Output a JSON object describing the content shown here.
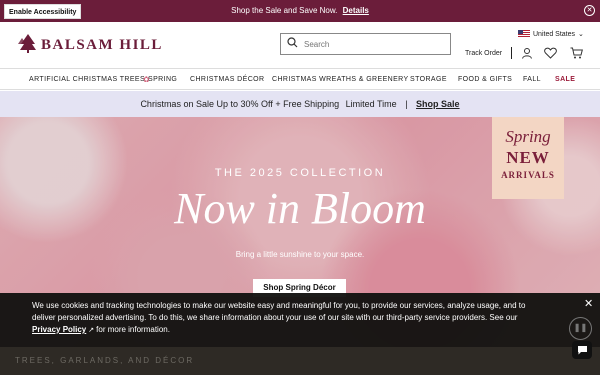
{
  "topbar": {
    "accessibility_label": "Enable Accessibility",
    "promo_text": "Shop the Sale and Save Now.",
    "promo_link": "Details",
    "close_icon": "close-circle-icon"
  },
  "header": {
    "logo_text": "BALSAM HILL",
    "search_placeholder": "Search",
    "country": "United States",
    "track_order": "Track Order",
    "icons": [
      "account-icon",
      "heart-icon",
      "cart-icon"
    ]
  },
  "nav": {
    "items": [
      "ARTIFICIAL CHRISTMAS TREES",
      "SPRING",
      "CHRISTMAS DÉCOR",
      "CHRISTMAS WREATHS & GREENERY",
      "STORAGE",
      "FOOD & GIFTS",
      "FALL",
      "SALE"
    ]
  },
  "sale_banner": {
    "text": "Christmas on Sale Up to 30% Off + Free Shipping",
    "limited": "Limited Time",
    "separator": "|",
    "link": "Shop Sale"
  },
  "hero": {
    "subtitle": "THE 2025 COLLECTION",
    "title": "Now in Bloom",
    "tagline": "Bring a little sunshine to your space.",
    "button": "Shop Spring Décor",
    "badge_line1": "Spring",
    "badge_line2": "NEW",
    "badge_line3": "ARRIVALS"
  },
  "strip": {
    "text": "TREES, GARLANDS, AND DÉCOR"
  },
  "cookie": {
    "message": "We use cookies and tracking technologies to make our website easy and meaningful for you, to provide our services, analyze usage, and to deliver personalized advertising. To do this, we share information about your use of our site with our third-party service providers. See our",
    "policy_link": "Privacy Policy",
    "suffix": "for more information.",
    "close": "✕"
  },
  "colors": {
    "brand": "#6b1d3a",
    "sale": "#9b1b3a",
    "banner_bg": "#e4e3f3"
  }
}
